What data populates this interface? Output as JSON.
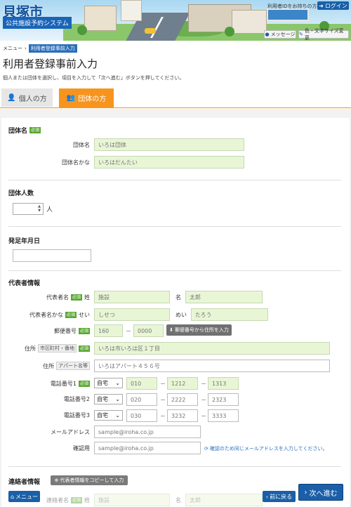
{
  "header": {
    "city": "貝塚市",
    "system": "公共施設予約システム",
    "id_text": "利用者IDをお持ちの方",
    "login_label": "ログイン",
    "message_label": "メッセージ",
    "font_label": "色・文字サイズ変更"
  },
  "breadcrumb": {
    "menu": "メニュー",
    "separator": "›",
    "current": "利用者登録事前入力"
  },
  "page": {
    "title": "利用者登録事前入力",
    "description": "個人または団体を選択し、項目を入力して「次へ進む」ボタンを押してください。"
  },
  "tabs": {
    "personal": "個人の方",
    "group": "団体の方"
  },
  "required": "必須",
  "group_name": {
    "title": "団体名",
    "name_label": "団体名",
    "name_placeholder": "いろは団体",
    "kana_label": "団体名かな",
    "kana_placeholder": "いろはだんたい"
  },
  "members": {
    "title": "団体人数",
    "unit": "人"
  },
  "founded": {
    "title": "発足年月日"
  },
  "rep": {
    "title": "代表者情報",
    "name_label": "代表者名",
    "sei_label": "姓",
    "sei_placeholder": "施設",
    "mei_label": "名",
    "mei_placeholder": "太郎",
    "kana_label": "代表者名かな",
    "sei_kana_label": "せい",
    "sei_kana_placeholder": "しせつ",
    "mei_kana_label": "めい",
    "mei_kana_placeholder": "たろう",
    "zip_label": "郵便番号",
    "zip1_placeholder": "160",
    "zip_dash": "－",
    "zip2_placeholder": "0000",
    "zip_button": "郵便番号から住所を入力",
    "addr_label": "住所",
    "addr1_tag": "市区町村・番地",
    "addr1_placeholder": "いろは市いろは区１丁目",
    "addr2_tag": "アパート名等",
    "addr2_placeholder": "いろはアパート４５６号",
    "phones": [
      {
        "label": "電話番号1",
        "type": "自宅",
        "p1": "010",
        "p2": "1212",
        "p3": "1313",
        "required": true
      },
      {
        "label": "電話番号2",
        "type": "自宅",
        "p1": "020",
        "p2": "2222",
        "p3": "2323",
        "required": false
      },
      {
        "label": "電話番号3",
        "type": "自宅",
        "p1": "030",
        "p2": "3232",
        "p3": "3333",
        "required": false
      }
    ],
    "phone_dash": "－",
    "email_label": "メールアドレス",
    "email_placeholder": "sample@iroha.co.jp",
    "confirm_label": "確認用",
    "confirm_placeholder": "sample@iroha.co.jp",
    "confirm_note": "確認のため同じメールアドレスを入力してください。"
  },
  "contact": {
    "title": "連絡者情報",
    "copy_button": "代表者情報をコピーして入力",
    "name_label": "連絡者名",
    "sei_label": "姓",
    "sei_placeholder": "施設",
    "mei_label": "名",
    "mei_placeholder": "太郎"
  },
  "footer": {
    "menu": "メニュー",
    "back": "前に戻る",
    "next": "次へ進む"
  },
  "colors": {
    "accent": "#f7941d",
    "primary": "#1a5fa8",
    "required": "#5aa832",
    "input_bg": "#e9f6d6"
  }
}
